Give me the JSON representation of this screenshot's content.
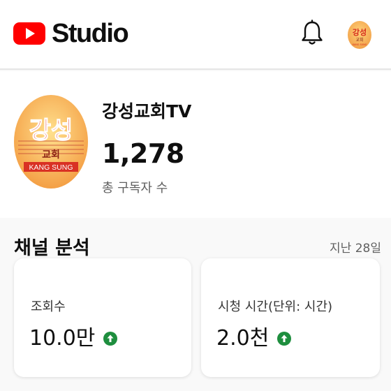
{
  "header": {
    "logo_text": "Studio",
    "brand_color": "#ff0000",
    "icons": [
      "youtube-play-icon",
      "bell-icon"
    ]
  },
  "avatar_text": {
    "main": "강성",
    "sub": "교회",
    "english": "KANG SUNG"
  },
  "channel": {
    "name": "강성교회TV",
    "subscriber_count": "1,278",
    "subscriber_label": "총 구독자 수"
  },
  "analytics": {
    "title": "채널 분석",
    "period": "지난 28일",
    "cards": [
      {
        "label": "조회수",
        "value": "10.0만",
        "trend": "up",
        "trend_icon": "arrow-up-circle-icon"
      },
      {
        "label": "시청 시간(단위: 시간)",
        "value": "2.0천",
        "trend": "up",
        "trend_icon": "arrow-up-circle-icon"
      }
    ],
    "trend_color": "#1e8e3e"
  }
}
